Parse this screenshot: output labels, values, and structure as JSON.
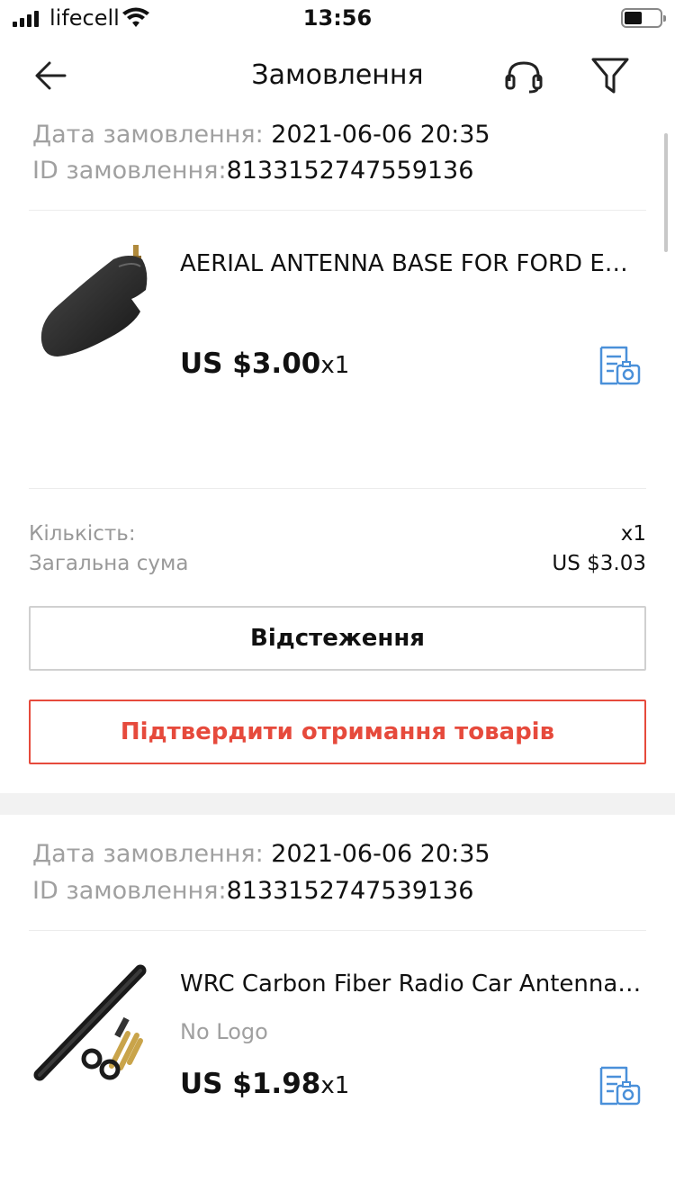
{
  "status_bar": {
    "carrier": "lifecell",
    "time": "13:56"
  },
  "nav": {
    "title": "Замовлення",
    "back_icon": "arrow-left-icon",
    "support_icon": "headset-icon",
    "filter_icon": "funnel-icon"
  },
  "orders": [
    {
      "date_label": "Дата замовлення:",
      "date_value": " 2021-06-06 20:35",
      "id_label": "ID замовлення:",
      "id_value": "8133152747559136",
      "product": {
        "title": "AERIAL ANTENNA BASE FOR FORD ESCORT",
        "price": "US $3.00",
        "qty": "x1"
      },
      "summary": {
        "qty_label": "Кількість:",
        "qty_value": "x1",
        "total_label": "Загальна сума",
        "total_value": "US $3.03"
      },
      "buttons": {
        "track": "Відстеження",
        "confirm": "Підтвердити отримання товарів"
      }
    },
    {
      "date_label": "Дата замовлення:",
      "date_value": " 2021-06-06 20:35",
      "id_label": "ID замовлення:",
      "id_value": "8133152747539136",
      "product": {
        "title": "WRC Carbon Fiber Radio Car Antenna Short",
        "brand": "No Logo",
        "price": "US $1.98",
        "qty": "x1"
      }
    }
  ],
  "colors": {
    "accent_red": "#e64a3c",
    "icon_blue": "#4a90d9",
    "muted_text": "#a0a0a0"
  }
}
